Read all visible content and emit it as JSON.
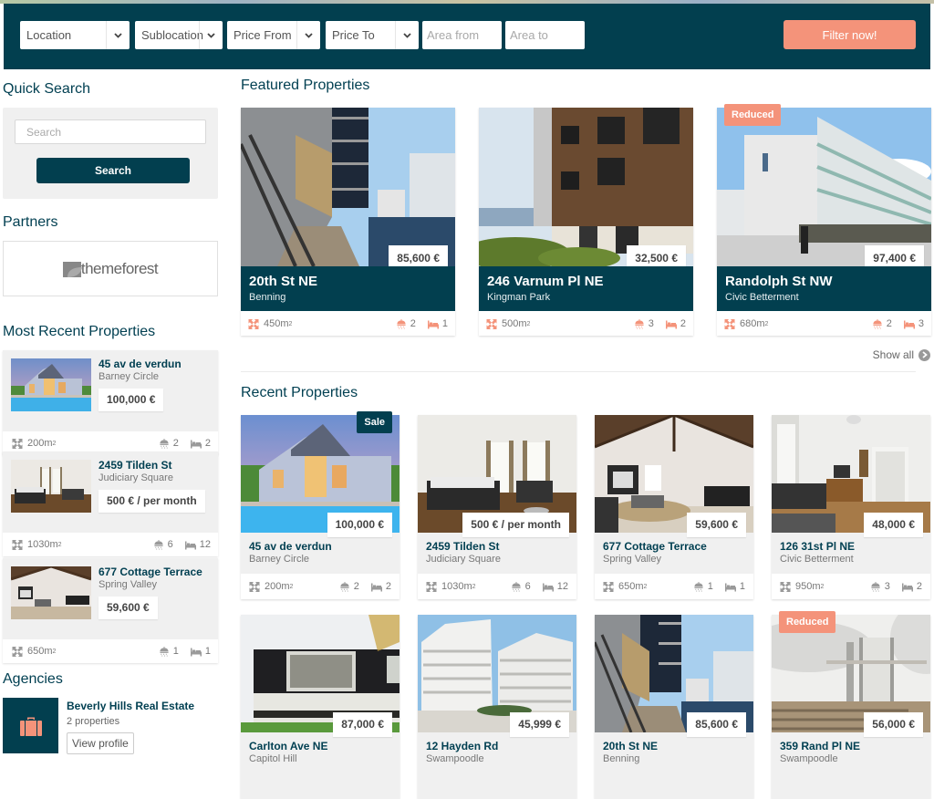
{
  "filter": {
    "location": "Location",
    "sublocation": "Sublocation",
    "price_from": "Price From",
    "price_to": "Price To",
    "area_from_placeholder": "Area from",
    "area_to_placeholder": "Area to",
    "submit_label": "Filter now!"
  },
  "sidebar": {
    "quick_search": {
      "title": "Quick Search",
      "placeholder": "Search",
      "button_label": "Search"
    },
    "partners": {
      "title": "Partners",
      "logo_text": "themeforest"
    },
    "most_recent": {
      "title": "Most Recent Properties",
      "items": [
        {
          "title": "45 av de verdun",
          "location": "Barney Circle",
          "price": "100,000 €",
          "area": "200m",
          "baths": "2",
          "beds": "2"
        },
        {
          "title": "2459 Tilden St",
          "location": "Judiciary Square",
          "price": "500 € / per month",
          "area": "1030m",
          "baths": "6",
          "beds": "12"
        },
        {
          "title": "677 Cottage Terrace",
          "location": "Spring Valley",
          "price": "59,600 €",
          "area": "650m",
          "baths": "1",
          "beds": "1"
        }
      ]
    },
    "agencies": {
      "title": "Agencies",
      "items": [
        {
          "name": "Beverly Hills Real Estate",
          "count": "2 properties",
          "button_label": "View profile"
        }
      ]
    }
  },
  "featured": {
    "title": "Featured Properties",
    "show_all_label": "Show all",
    "items": [
      {
        "title": "20th St NE",
        "location": "Benning",
        "price": "85,600 €",
        "area": "450m",
        "baths": "2",
        "beds": "1",
        "badge": ""
      },
      {
        "title": "246 Varnum Pl NE",
        "location": "Kingman Park",
        "price": "32,500 €",
        "area": "500m",
        "baths": "3",
        "beds": "2",
        "badge": ""
      },
      {
        "title": "Randolph St NW",
        "location": "Civic Betterment",
        "price": "97,400 €",
        "area": "680m",
        "baths": "2",
        "beds": "3",
        "badge": "Reduced"
      }
    ]
  },
  "recent": {
    "title": "Recent Properties",
    "items": [
      {
        "title": "45 av de verdun",
        "location": "Barney Circle",
        "price": "100,000 €",
        "area": "200m",
        "baths": "2",
        "beds": "2",
        "badge": "Sale"
      },
      {
        "title": "2459 Tilden St",
        "location": "Judiciary Square",
        "price": "500 € / per month",
        "area": "1030m",
        "baths": "6",
        "beds": "12",
        "badge": ""
      },
      {
        "title": "677 Cottage Terrace",
        "location": "Spring Valley",
        "price": "59,600 €",
        "area": "650m",
        "baths": "1",
        "beds": "1",
        "badge": ""
      },
      {
        "title": "126 31st Pl NE",
        "location": "Civic Betterment",
        "price": "48,000 €",
        "area": "950m",
        "baths": "3",
        "beds": "2",
        "badge": ""
      },
      {
        "title": "Carlton Ave NE",
        "location": "Capitol Hill",
        "price": "87,000 €",
        "badge": ""
      },
      {
        "title": "12 Hayden Rd",
        "location": "Swampoodle",
        "price": "45,999 €",
        "badge": ""
      },
      {
        "title": "20th St NE",
        "location": "Benning",
        "price": "85,600 €",
        "badge": ""
      },
      {
        "title": "359 Rand Pl NE",
        "location": "Swampoodle",
        "price": "56,000 €",
        "badge": "Reduced"
      }
    ]
  },
  "area_unit_sup": "2",
  "colors": {
    "primary": "#023f4f",
    "accent": "#f4937a",
    "panel": "#f0f0f0"
  },
  "icons": {
    "area": "area-arrows-icon",
    "bath": "shower-icon",
    "bed": "bed-icon",
    "agency": "briefcase-icon",
    "show_all": "chevron-right-circle-icon",
    "dropdown": "chevron-down-icon"
  }
}
